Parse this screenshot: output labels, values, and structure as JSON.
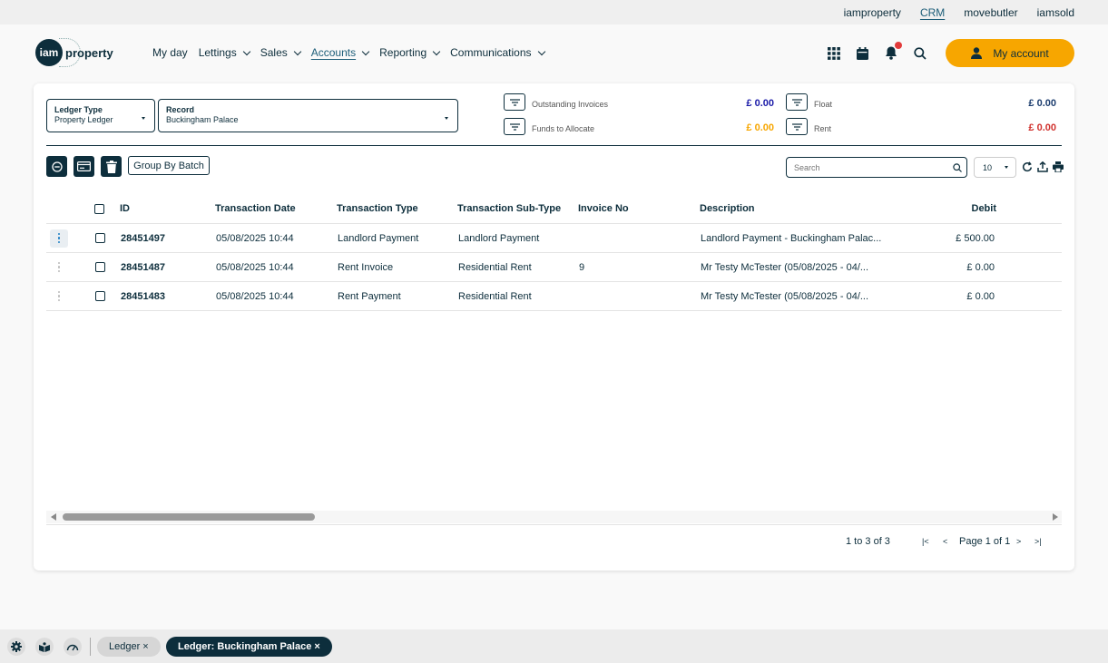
{
  "topbar": {
    "links": [
      "iamproperty",
      "CRM",
      "movebutler",
      "iamsold"
    ],
    "active": "CRM"
  },
  "logo": {
    "mark": "iam",
    "word": "property"
  },
  "nav": {
    "items": [
      "My day",
      "Lettings",
      "Sales",
      "Accounts",
      "Reporting",
      "Communications"
    ],
    "active": "Accounts",
    "icons": [
      "apps-grid-icon",
      "calendar-icon",
      "bell-icon",
      "search-icon"
    ],
    "notification_count": "1",
    "account_label": "My account"
  },
  "filters": {
    "ledger_type": {
      "label": "Ledger Type",
      "value": "Property Ledger"
    },
    "record": {
      "label": "Record",
      "value": "Buckingham Palace"
    }
  },
  "summary": {
    "outstanding_invoices": {
      "label": "Outstanding Invoices",
      "value": "£ 0.00",
      "color": "#1a1aa8"
    },
    "funds_to_allocate": {
      "label": "Funds to Allocate",
      "value": "£ 0.00",
      "color": "#f7a600"
    },
    "float": {
      "label": "Float",
      "value": "£ 0.00",
      "color": "#1c3d6e"
    },
    "rent": {
      "label": "Rent",
      "value": "£ 0.00",
      "color": "#d0312d"
    }
  },
  "toolbar": {
    "group_by_batch": "Group By Batch",
    "search_placeholder": "Search",
    "page_size": "10"
  },
  "table": {
    "columns": [
      "ID",
      "Transaction Date",
      "Transaction Type",
      "Transaction Sub-Type",
      "Invoice No",
      "Description",
      "Debit"
    ],
    "rows": [
      {
        "id": "28451497",
        "date": "05/08/2025 10:44",
        "type": "Landlord Payment",
        "subtype": "Landlord Payment",
        "invoice": "",
        "description": "Landlord Payment - Buckingham Palac...",
        "debit": "£ 500.00"
      },
      {
        "id": "28451487",
        "date": "05/08/2025 10:44",
        "type": "Rent Invoice",
        "subtype": "Residential Rent",
        "invoice": "9",
        "description": "Mr Testy McTester (05/08/2025 - 04/...",
        "debit": "£ 0.00"
      },
      {
        "id": "28451483",
        "date": "05/08/2025 10:44",
        "type": "Rent Payment",
        "subtype": "Residential Rent",
        "invoice": "",
        "description": "Mr Testy McTester (05/08/2025 - 04/...",
        "debit": "£ 0.00"
      }
    ]
  },
  "pagination": {
    "range": "1 to 3 of 3",
    "page": "Page 1 of 1"
  },
  "bottom": {
    "tabs": [
      {
        "label": "Ledger ×",
        "active": false
      },
      {
        "label": "Ledger: Buckingham Palace ×",
        "active": true
      }
    ]
  }
}
